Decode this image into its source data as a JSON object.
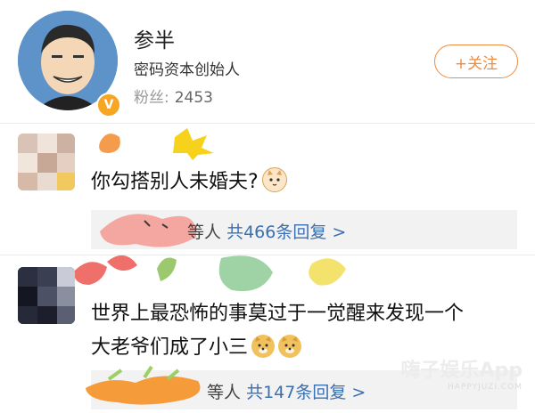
{
  "profile": {
    "name": "参半",
    "bio": "密码资本创始人",
    "fans_label": "粉丝:",
    "fans_count": "2453",
    "verified_icon": "V",
    "follow_button": "+关注"
  },
  "comments": [
    {
      "text": "你勾搭别人未婚夫?",
      "emoji": [
        "cat-face-icon"
      ],
      "reply_prefix": "等人",
      "reply_count": "共466条回复 >"
    },
    {
      "text_line1": "世界上最恐怖的事莫过于一觉醒来发现一个",
      "text_line2": "大老爷们成了小三",
      "emoji": [
        "doge-icon",
        "doge-icon"
      ],
      "reply_prefix": "等人",
      "reply_count": "共147条回复 >"
    }
  ],
  "watermark": {
    "title": "嗨子娱乐App",
    "subtitle": "HAPPYJUZI.COM"
  },
  "colors": {
    "accent": "#f08a3c",
    "link": "#3a6fb0"
  }
}
